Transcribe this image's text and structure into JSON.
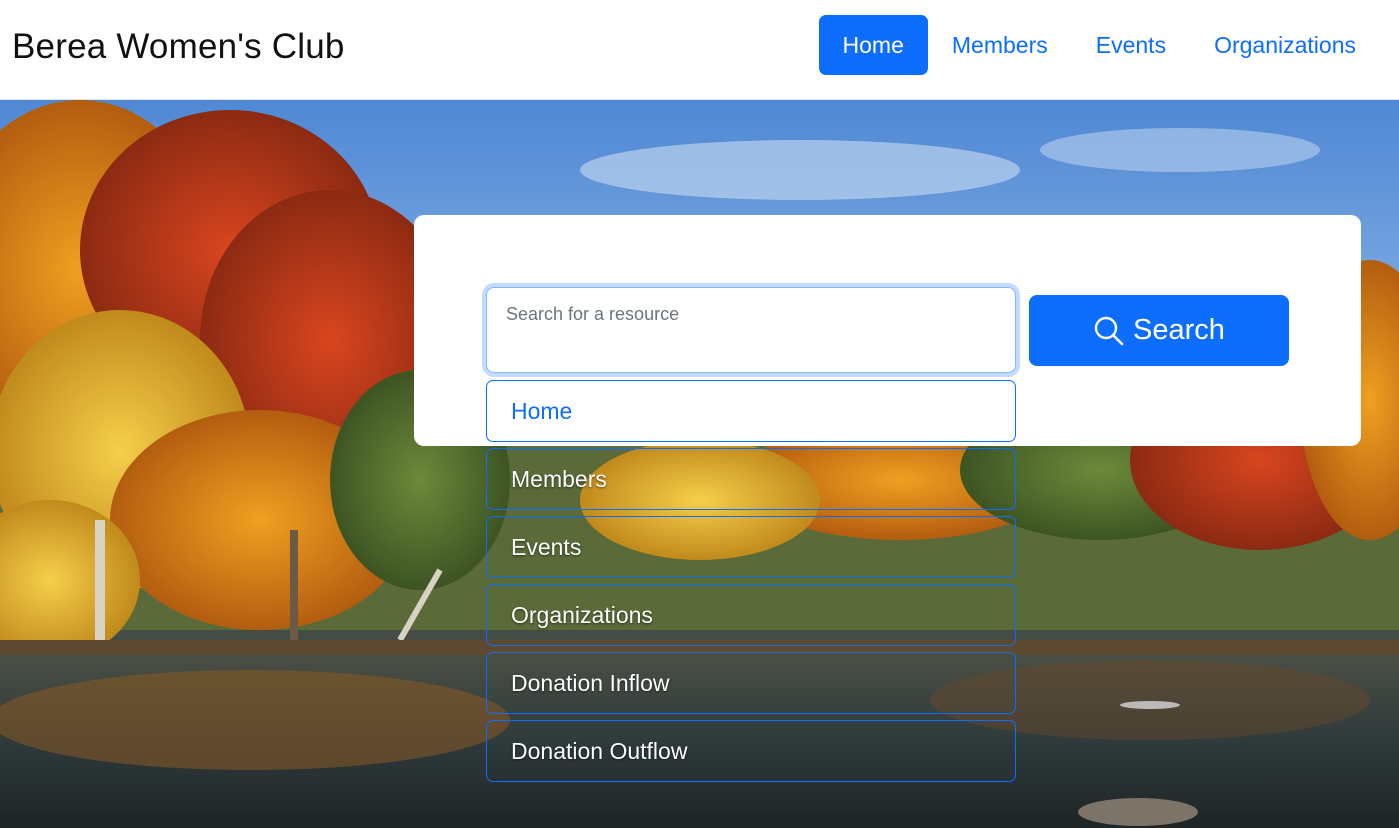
{
  "brand": "Berea Women's Club",
  "nav": {
    "items": [
      {
        "label": "Home",
        "active": true
      },
      {
        "label": "Members",
        "active": false
      },
      {
        "label": "Events",
        "active": false
      },
      {
        "label": "Organizations",
        "active": false
      }
    ]
  },
  "hero": {
    "background": "autumn-lake-photo"
  },
  "search": {
    "placeholder": "Search for a resource",
    "value": "",
    "button_label": "Search",
    "button_icon": "search-icon"
  },
  "suggestions": [
    {
      "label": "Home"
    },
    {
      "label": "Members"
    },
    {
      "label": "Events"
    },
    {
      "label": "Organizations"
    },
    {
      "label": "Donation Inflow"
    },
    {
      "label": "Donation Outflow"
    }
  ],
  "colors": {
    "primary": "#0d6efd",
    "text": "#111111",
    "placeholder": "#6c757d"
  }
}
